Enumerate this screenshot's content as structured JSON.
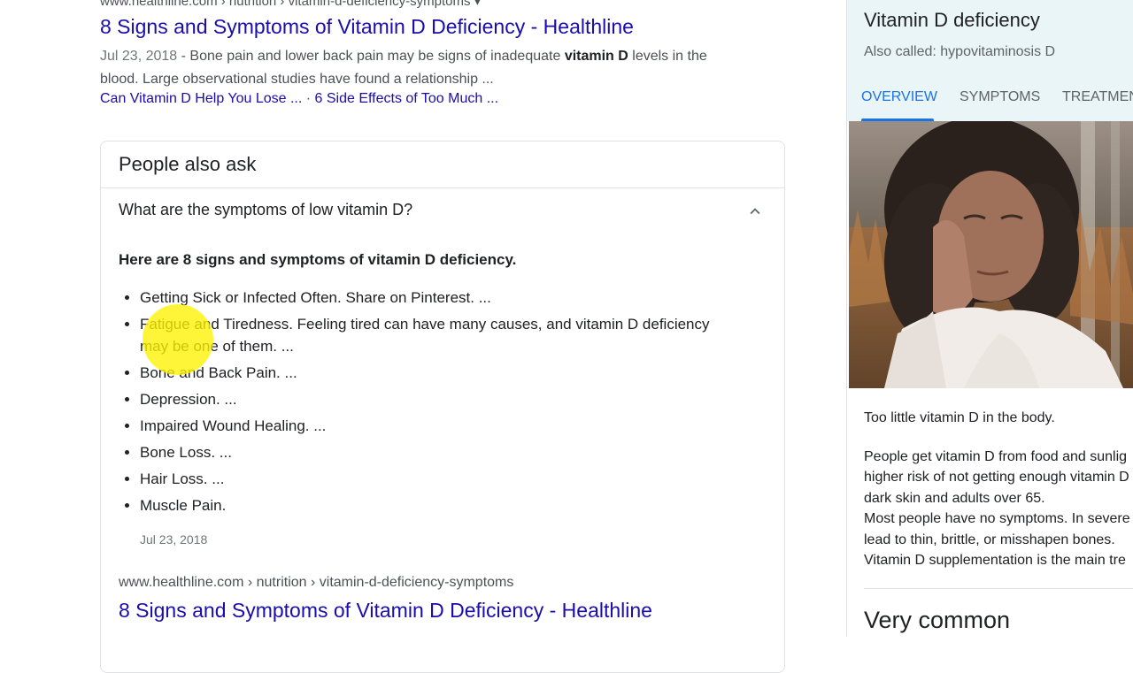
{
  "top_result": {
    "cite": "www.healthline.com › nutrition › vitamin-d-deficiency-symptoms  ▾",
    "title": "8 Signs and Symptoms of Vitamin D Deficiency - Healthline",
    "date": "Jul 23, 2018",
    "snippet_dash": " - ",
    "snippet_pre": "Bone pain and lower back pain may be signs of inadequate ",
    "snippet_bold": "vitamin D",
    "snippet_post": " levels in the blood. Large observational studies have found a relationship ...",
    "sitelink_1": "Can Vitamin D Help You Lose ...",
    "sitelink_sep": " · ",
    "sitelink_2": "6 Side Effects of Too Much ..."
  },
  "paa": {
    "heading": "People also ask",
    "question": "What are the symptoms of low vitamin D?",
    "answer_heading": "Here are 8 signs and symptoms of vitamin D deficiency.",
    "items": [
      "Getting Sick or Infected Often. Share on Pinterest. ...",
      "Fatigue and Tiredness. Feeling tired can have many causes, and vitamin D deficiency may be one of them. ...",
      "Bone and Back Pain. ...",
      "Depression. ...",
      "Impaired Wound Healing. ...",
      "Bone Loss. ...",
      "Hair Loss. ...",
      "Muscle Pain."
    ],
    "answer_date": "Jul 23, 2018",
    "source_cite": "www.healthline.com › nutrition › vitamin-d-deficiency-symptoms",
    "source_title": "8 Signs and Symptoms of Vitamin D Deficiency - Healthline"
  },
  "knowledge_panel": {
    "title": "Vitamin D deficiency",
    "also_called": "Also called: hypovitaminosis D",
    "tabs": [
      "OVERVIEW",
      "SYMPTOMS",
      "TREATMENTS"
    ],
    "active_tab": "OVERVIEW",
    "summary": "Too little vitamin D in the body.",
    "body_lines_1": [
      "People get vitamin D from food and sunlig",
      "higher risk of not getting enough vitamin D",
      "dark skin and adults over 65."
    ],
    "body_lines_2": [
      "Most people have no symptoms. In severe",
      "lead to thin, brittle, or misshapen bones."
    ],
    "body_lines_3": [
      "Vitamin D supplementation is the main tre"
    ],
    "prevalence": "Very common"
  },
  "icons": {
    "collapse": "chevron-up-icon"
  },
  "colors": {
    "link": "#1a0dab",
    "accent": "#1a73e8",
    "panel_header": "#eaf5f7",
    "cursor_highlight": "#fff200"
  }
}
